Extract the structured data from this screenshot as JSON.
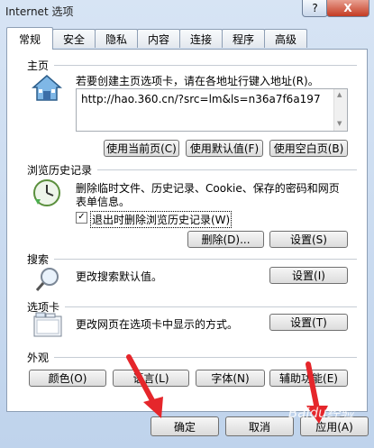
{
  "window": {
    "title": "Internet 选项",
    "help_label": "?",
    "close_label": "X"
  },
  "tabs": [
    {
      "label": "常规"
    },
    {
      "label": "安全"
    },
    {
      "label": "隐私"
    },
    {
      "label": "内容"
    },
    {
      "label": "连接"
    },
    {
      "label": "程序"
    },
    {
      "label": "高级"
    }
  ],
  "home": {
    "title": "主页",
    "description": "若要创建主页选项卡，请在各地址行键入地址(R)。",
    "address": "http://hao.360.cn/?src=lm&ls=n36a7f6a197",
    "use_current": "使用当前页(C)",
    "use_default": "使用默认值(F)",
    "use_blank": "使用空白页(B)"
  },
  "history": {
    "title": "浏览历史记录",
    "description_line1": "删除临时文件、历史记录、Cookie、保存的密码和网页",
    "description_line2": "表单信息。",
    "checkbox_label": "退出时删除浏览历史记录(W)",
    "checkbox_mark": "✓",
    "delete_button": "删除(D)...",
    "settings_button": "设置(S)"
  },
  "search": {
    "title": "搜索",
    "description": "更改搜索默认值。",
    "settings_button": "设置(I)"
  },
  "tabs_section": {
    "title": "选项卡",
    "description": "更改网页在选项卡中显示的方式。",
    "settings_button": "设置(T)"
  },
  "appearance": {
    "title": "外观",
    "colors": "颜色(O)",
    "languages": "语言(L)",
    "fonts": "字体(N)",
    "accessibility": "辅助功能(E)"
  },
  "footer": {
    "ok": "确定",
    "cancel": "取消",
    "apply": "应用(A)"
  },
  "watermark": "Baidu经验",
  "colors": {
    "accent_arrow": "#e5262b",
    "panel_border": "#8e9fb5"
  }
}
